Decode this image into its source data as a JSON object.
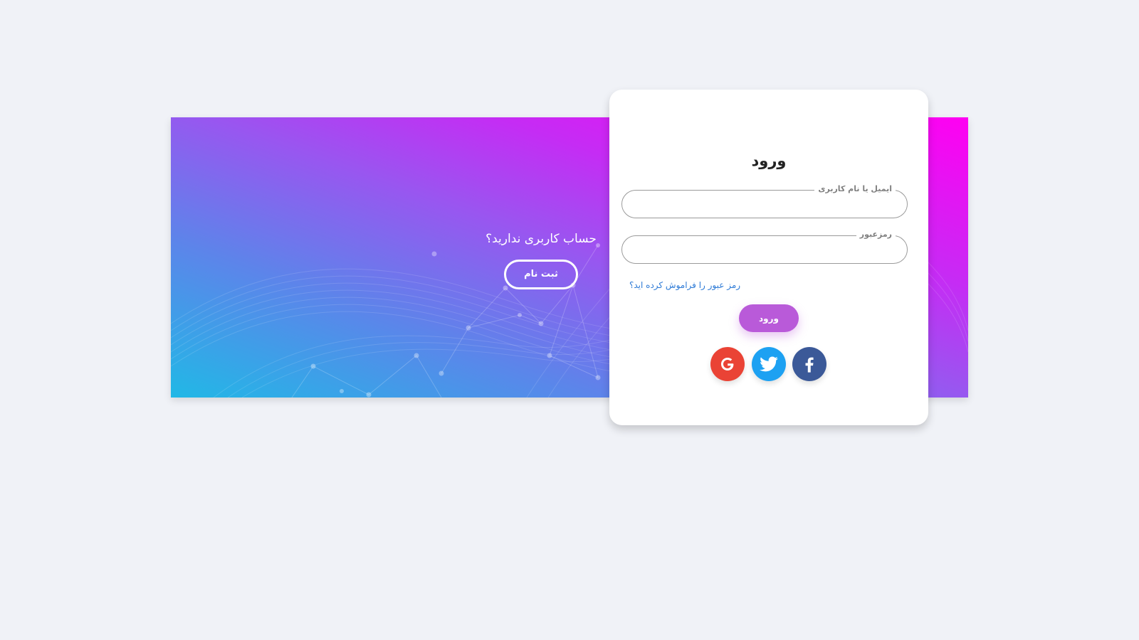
{
  "banner": {
    "prompt": "حساب کاربری ندارید؟",
    "signup_label": "ثبت نام"
  },
  "login": {
    "title": "ورود",
    "email_label": "ایمیل یا نام کاربری",
    "email_value": "",
    "password_label": "رمزعبور",
    "password_value": "",
    "forgot_label": "رمز عبور را فراموش کرده اید؟",
    "submit_label": "ورود"
  },
  "social": [
    {
      "name": "google",
      "icon": "google-icon",
      "color": "#ea4335"
    },
    {
      "name": "twitter",
      "icon": "twitter-icon",
      "color": "#1da1f2"
    },
    {
      "name": "facebook",
      "icon": "facebook-icon",
      "color": "#3b5998"
    }
  ],
  "colors": {
    "background": "#f0f2f7",
    "gradient_start": "#21b8e6",
    "gradient_end": "#ff00f2",
    "login_button": "#b95ad9",
    "link": "#2d7ad6"
  }
}
